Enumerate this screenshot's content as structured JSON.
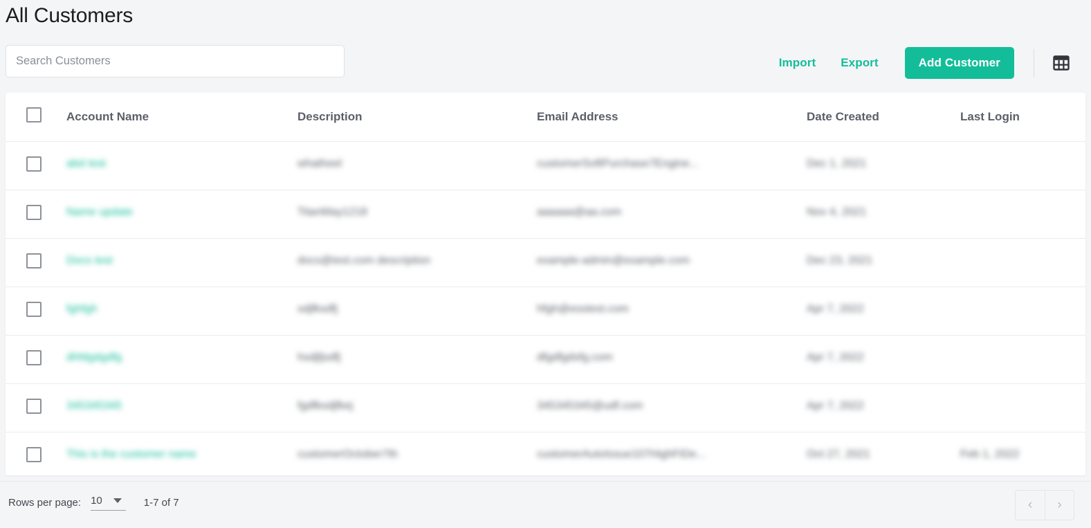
{
  "header": {
    "title": "All Customers"
  },
  "search": {
    "placeholder": "Search Customers",
    "value": ""
  },
  "toolbar": {
    "import_label": "Import",
    "export_label": "Export",
    "add_customer_label": "Add Customer",
    "grid_view_icon": "table-grid-icon",
    "accent_color": "#13bd9a"
  },
  "table": {
    "columns": [
      {
        "key": "select",
        "label": ""
      },
      {
        "key": "account_name",
        "label": "Account Name"
      },
      {
        "key": "description",
        "label": "Description"
      },
      {
        "key": "email",
        "label": "Email Address"
      },
      {
        "key": "date_created",
        "label": "Date Created"
      },
      {
        "key": "last_login",
        "label": "Last Login"
      }
    ],
    "rows": [
      {
        "account_name": "abd test",
        "description": "whatheel",
        "email": "customerSoftPurchase7Engine...",
        "date_created": "Dec 1, 2021",
        "last_login": ""
      },
      {
        "account_name": "Name update",
        "description": "TitanMay1218",
        "email": "aaaaaa@aa.com",
        "date_created": "Nov 4, 2021",
        "last_login": ""
      },
      {
        "account_name": "Docs test",
        "description": "docs@test.com description",
        "email": "example-admin@example.com",
        "date_created": "Dec 23, 2021",
        "last_login": ""
      },
      {
        "account_name": "fghfgh",
        "description": "sdjfksdfj",
        "email": "hfgh@esstest.com",
        "date_created": "Apr 7, 2022",
        "last_login": ""
      },
      {
        "account_name": "dhfdgdgdfg",
        "description": "hsdjfjsdfj",
        "email": "dfgdfgdsfg.com",
        "date_created": "Apr 7, 2022",
        "last_login": ""
      },
      {
        "account_name": "345345345",
        "description": "fgdfksdjfkej",
        "email": "345345345@udf.com",
        "date_created": "Apr 7, 2022",
        "last_login": ""
      },
      {
        "account_name": "This is the customer name",
        "description": "customerOctober7th",
        "email": "customerAutoIssue107HighFiDe...",
        "date_created": "Oct 27, 2021",
        "last_login": "Feb 1, 2022"
      }
    ]
  },
  "footer": {
    "rows_per_page_label": "Rows per page:",
    "rows_per_page_value": "10",
    "range_text": "1-7 of 7",
    "prev_label": "‹",
    "next_label": "›"
  }
}
